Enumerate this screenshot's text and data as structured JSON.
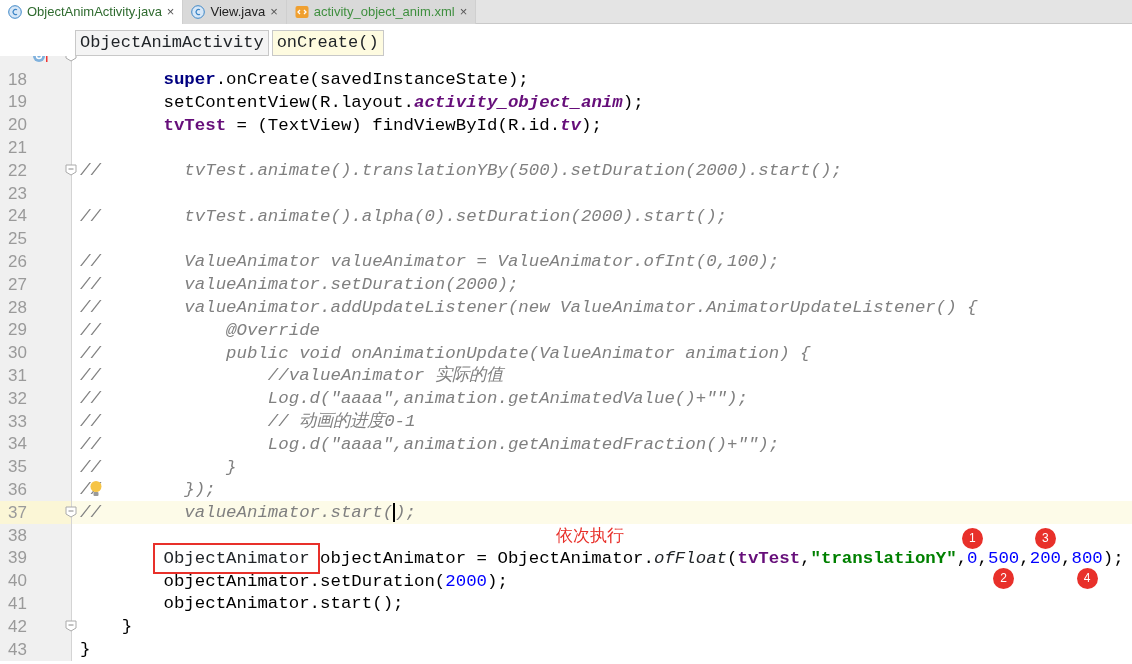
{
  "tabs": [
    {
      "label": "ObjectAnimActivity.java",
      "kind": "class",
      "color": "#2f6b2f",
      "selected": true,
      "close": "×"
    },
    {
      "label": "View.java",
      "kind": "class",
      "color": "#222222",
      "selected": false,
      "close": "×"
    },
    {
      "label": "activity_object_anim.xml",
      "kind": "xml",
      "color": "#3f8f3f",
      "selected": false,
      "close": "×"
    }
  ],
  "breadcrumb": [
    {
      "label": "ObjectAnimActivity",
      "selected": false
    },
    {
      "label": "onCreate()",
      "selected": true
    }
  ],
  "lines": [
    {
      "override": true,
      "fold": true
    },
    {
      "number": "18",
      "segments": [
        {
          "kind": "keyword",
          "text": "        super"
        },
        {
          "kind": "plain",
          "text": ".onCreate(savedInstanceState);"
        }
      ]
    },
    {
      "number": "19",
      "segments": [
        {
          "kind": "plain",
          "text": "        setContentView(R.layout."
        },
        {
          "kind": "static",
          "text": "activity_object_anim"
        },
        {
          "kind": "plain",
          "text": ");"
        }
      ]
    },
    {
      "number": "20",
      "segments": [
        {
          "kind": "field",
          "text": "        tvTest"
        },
        {
          "kind": "plain",
          "text": " = (TextView) findViewById(R.id."
        },
        {
          "kind": "static",
          "text": "tv"
        },
        {
          "kind": "plain",
          "text": ");"
        }
      ]
    },
    {
      "number": "21"
    },
    {
      "number": "22",
      "fold": true,
      "segments": [
        {
          "kind": "comment",
          "text": "//        tvTest.animate().translationYBy(500).setDuration(2000).start();"
        }
      ]
    },
    {
      "number": "23"
    },
    {
      "number": "24",
      "segments": [
        {
          "kind": "comment",
          "text": "//        tvTest.animate().alpha(0).setDuration(2000).start();"
        }
      ]
    },
    {
      "number": "25"
    },
    {
      "number": "26",
      "segments": [
        {
          "kind": "comment",
          "text": "//        ValueAnimator valueAnimator = ValueAnimator.ofInt(0,100);"
        }
      ]
    },
    {
      "number": "27",
      "segments": [
        {
          "kind": "comment",
          "text": "//        valueAnimator.setDuration(2000);"
        }
      ]
    },
    {
      "number": "28",
      "segments": [
        {
          "kind": "comment",
          "text": "//        valueAnimator.addUpdateListener(new ValueAnimator.AnimatorUpdateListener() {"
        }
      ]
    },
    {
      "number": "29",
      "segments": [
        {
          "kind": "comment",
          "text": "//            @Override"
        }
      ]
    },
    {
      "number": "30",
      "segments": [
        {
          "kind": "comment",
          "text": "//            public void onAnimationUpdate(ValueAnimator animation) {"
        }
      ]
    },
    {
      "number": "31",
      "segments": [
        {
          "kind": "comment",
          "text": "//                //valueAnimator 实际的值"
        }
      ]
    },
    {
      "number": "32",
      "segments": [
        {
          "kind": "comment",
          "text": "//                Log.d(\"aaaa\",animation.getAnimatedValue()+\"\");"
        }
      ]
    },
    {
      "number": "33",
      "segments": [
        {
          "kind": "comment",
          "text": "//                // 动画的进度0-1"
        }
      ]
    },
    {
      "number": "34",
      "segments": [
        {
          "kind": "comment",
          "text": "//                Log.d(\"aaaa\",animation.getAnimatedFraction()+\"\");"
        }
      ]
    },
    {
      "number": "35",
      "segments": [
        {
          "kind": "comment",
          "text": "//            }"
        }
      ]
    },
    {
      "number": "36",
      "bulb": true,
      "segments": [
        {
          "kind": "comment",
          "text": "//        });"
        }
      ]
    },
    {
      "number": "37",
      "current": true,
      "fold": true,
      "segments": [
        {
          "kind": "comment",
          "text": "//        valueAnimator.start(",
          "caret": true
        },
        {
          "kind": "comment",
          "text": ");"
        }
      ]
    },
    {
      "number": "38",
      "segments": [
        {
          "kind": "note",
          "text": "依次执行"
        }
      ]
    },
    {
      "number": "39",
      "segments": [
        {
          "kind": "boxed",
          "text": "ObjectAnimator"
        },
        {
          "kind": "plain",
          "text": " objectAnimator = ObjectAnimator."
        },
        {
          "kind": "method",
          "text": "ofFloat"
        },
        {
          "kind": "plain",
          "text": "("
        },
        {
          "kind": "field",
          "text": "tvTest"
        },
        {
          "kind": "plain",
          "text": ","
        },
        {
          "kind": "string",
          "text": "\"translationY\""
        },
        {
          "kind": "plain",
          "text": ","
        },
        {
          "kind": "number",
          "text": "0",
          "marker": "1"
        },
        {
          "kind": "plain",
          "text": ","
        },
        {
          "kind": "number",
          "text": "500",
          "marker": "2"
        },
        {
          "kind": "plain",
          "text": ","
        },
        {
          "kind": "number",
          "text": "200",
          "marker": "3"
        },
        {
          "kind": "plain",
          "text": ","
        },
        {
          "kind": "number",
          "text": "800",
          "marker": "4"
        },
        {
          "kind": "plain",
          "text": ");"
        }
      ]
    },
    {
      "number": "40",
      "segments": [
        {
          "kind": "plain",
          "text": "        objectAnimator.setDuration("
        },
        {
          "kind": "number",
          "text": "2000"
        },
        {
          "kind": "plain",
          "text": ");"
        }
      ]
    },
    {
      "number": "41",
      "segments": [
        {
          "kind": "plain",
          "text": "        objectAnimator.start();"
        }
      ]
    },
    {
      "number": "42",
      "fold": true,
      "segments": [
        {
          "kind": "plain",
          "text": "    }"
        }
      ]
    },
    {
      "number": "43",
      "segments": [
        {
          "kind": "plain",
          "text": "}"
        }
      ]
    }
  ]
}
